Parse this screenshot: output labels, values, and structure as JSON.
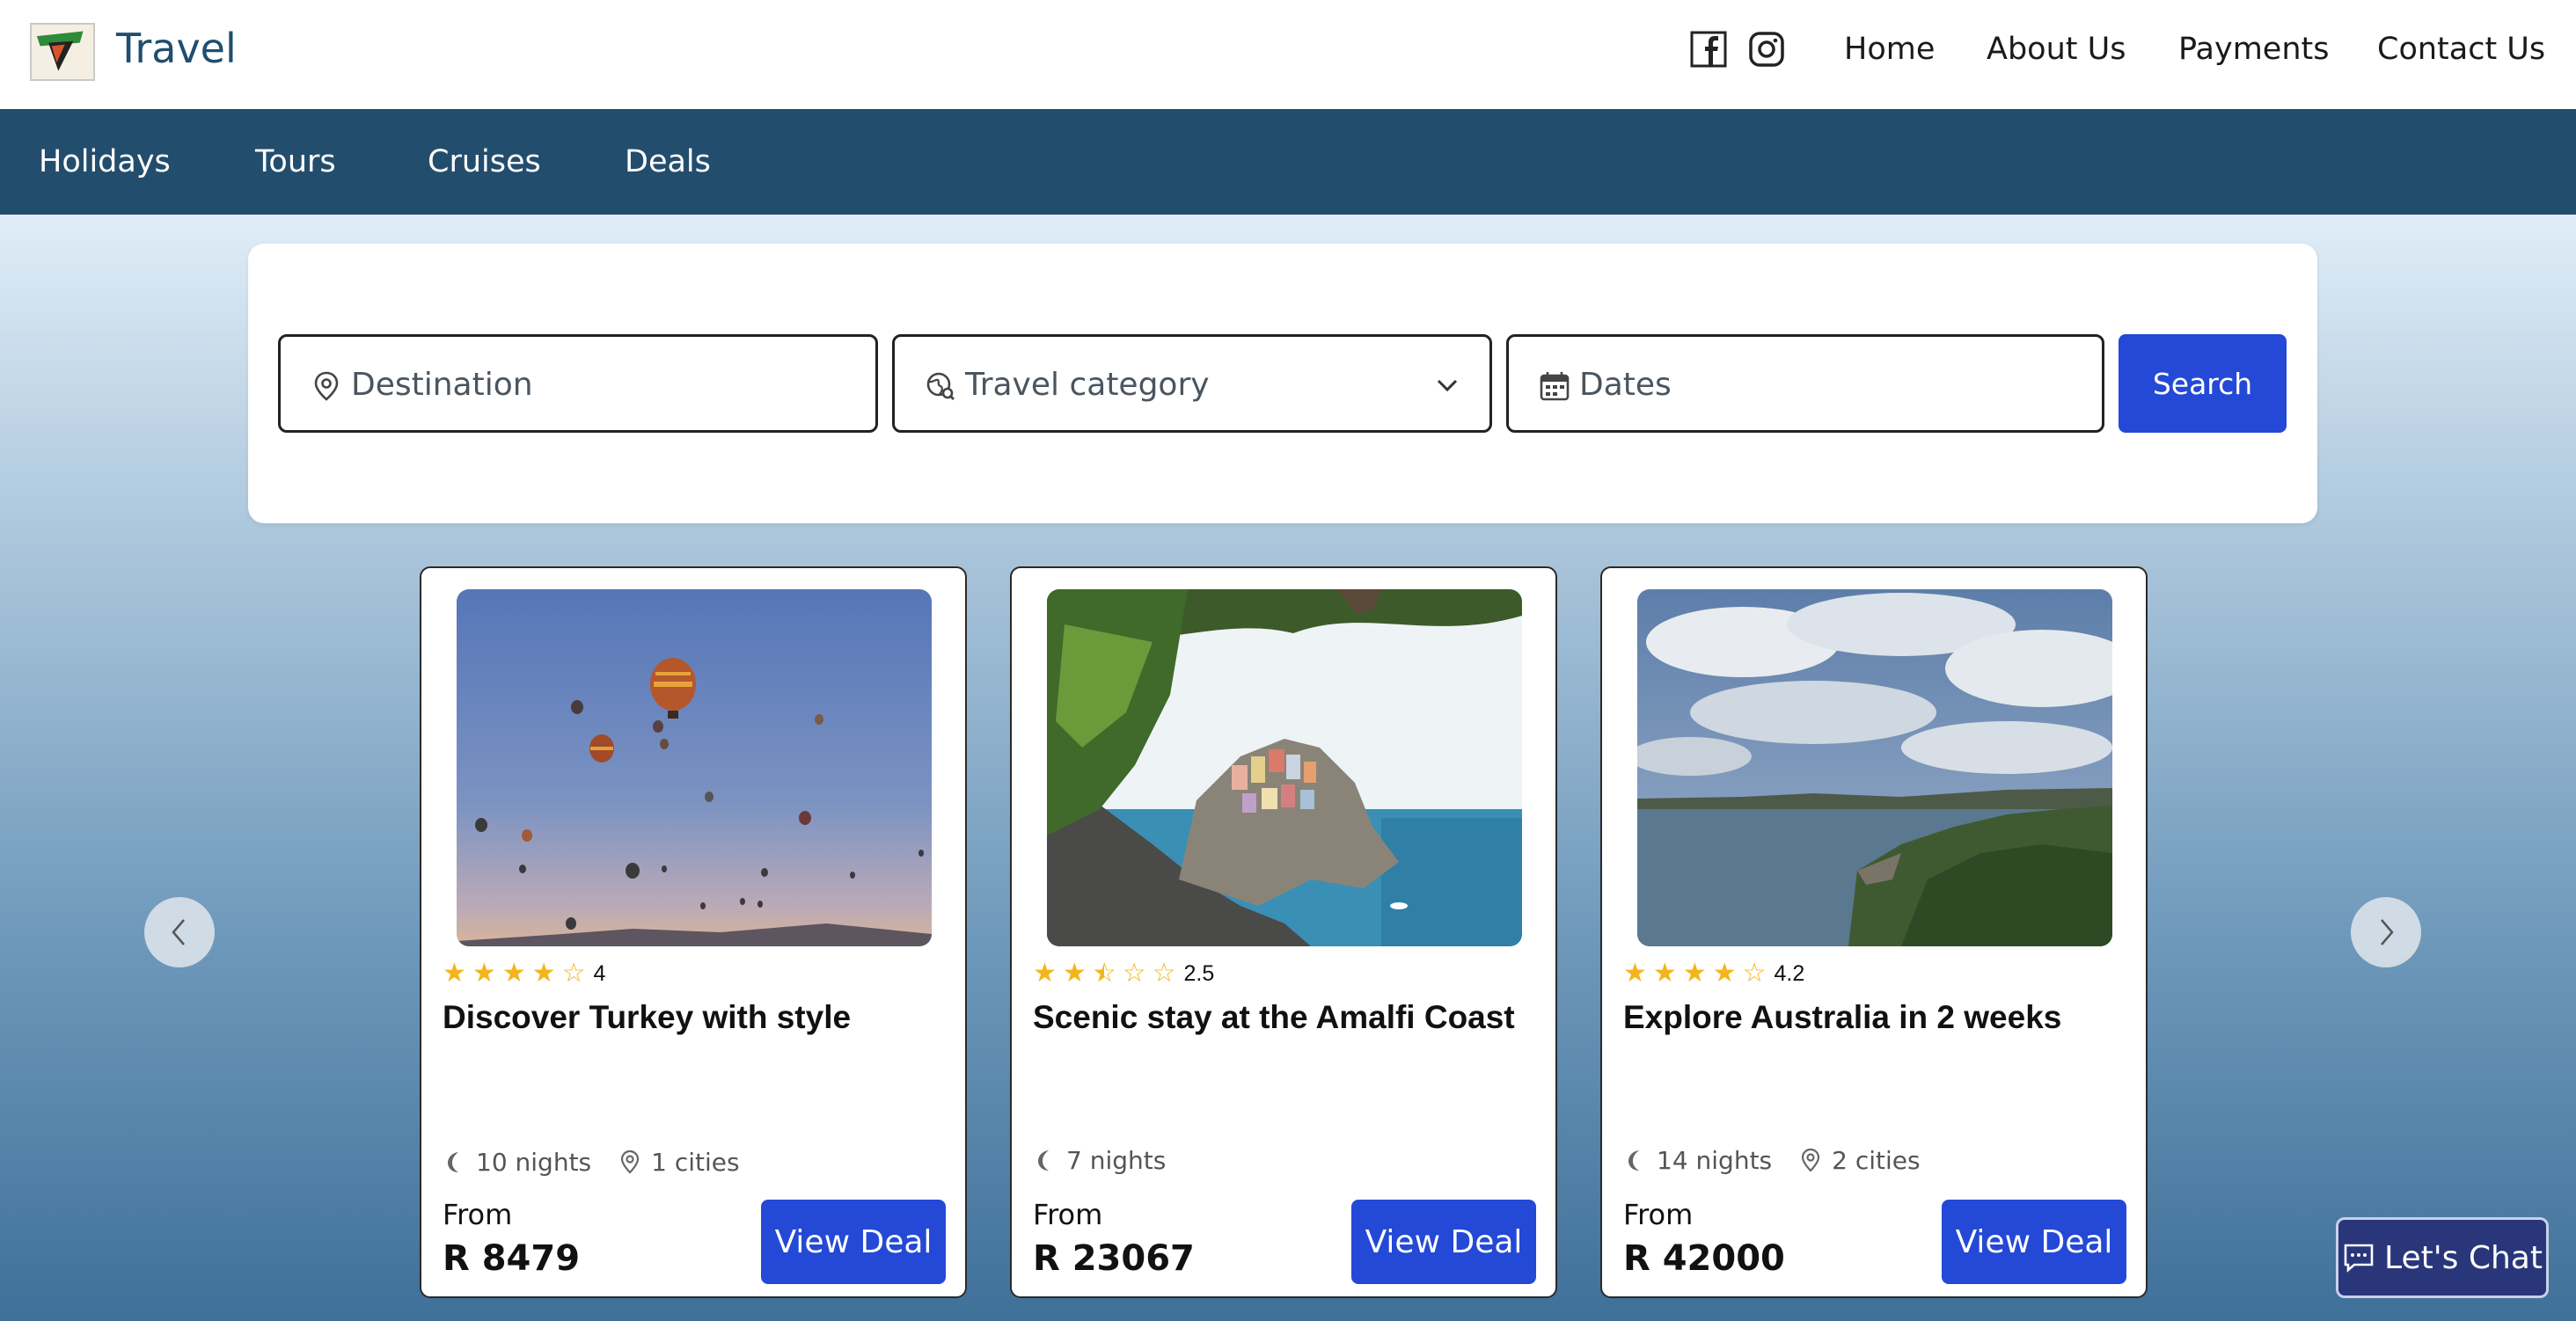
{
  "header": {
    "brand": "Travel",
    "nav": [
      "Home",
      "About Us",
      "Payments",
      "Contact Us"
    ],
    "icons": [
      "facebook-icon",
      "instagram-icon"
    ]
  },
  "categories": [
    "Holidays",
    "Tours",
    "Cruises",
    "Deals"
  ],
  "search": {
    "destination_placeholder": "Destination",
    "category_placeholder": "Travel category",
    "dates_placeholder": "Dates",
    "search_label": "Search"
  },
  "cards": [
    {
      "title": "Discover Turkey with style",
      "rating": "4",
      "stars": [
        1,
        1,
        1,
        1,
        0
      ],
      "nights": "10 nights",
      "cities": "1 cities",
      "from_label": "From",
      "price": "R 8479",
      "button": "View Deal",
      "image": "hot-air-balloons-sky"
    },
    {
      "title": "Scenic stay at the Amalfi Coast",
      "rating": "2.5",
      "stars": [
        1,
        1,
        0.5,
        0,
        0
      ],
      "nights": "7 nights",
      "cities": "",
      "from_label": "From",
      "price": "R 23067",
      "button": "View Deal",
      "image": "coastal-village-cliff"
    },
    {
      "title": "Explore Australia in 2 weeks",
      "rating": "4.2",
      "stars": [
        1,
        1,
        1,
        1,
        0
      ],
      "nights": "14 nights",
      "cities": "2 cities",
      "from_label": "From",
      "price": "R 42000",
      "button": "View Deal",
      "image": "coastline-cloudy-sky"
    }
  ],
  "chat": {
    "label": "Let's Chat"
  },
  "colors": {
    "nav_bar": "#234d6d",
    "primary_button": "#2449d6",
    "star": "#f3b51b",
    "chat_button": "#29367a"
  }
}
